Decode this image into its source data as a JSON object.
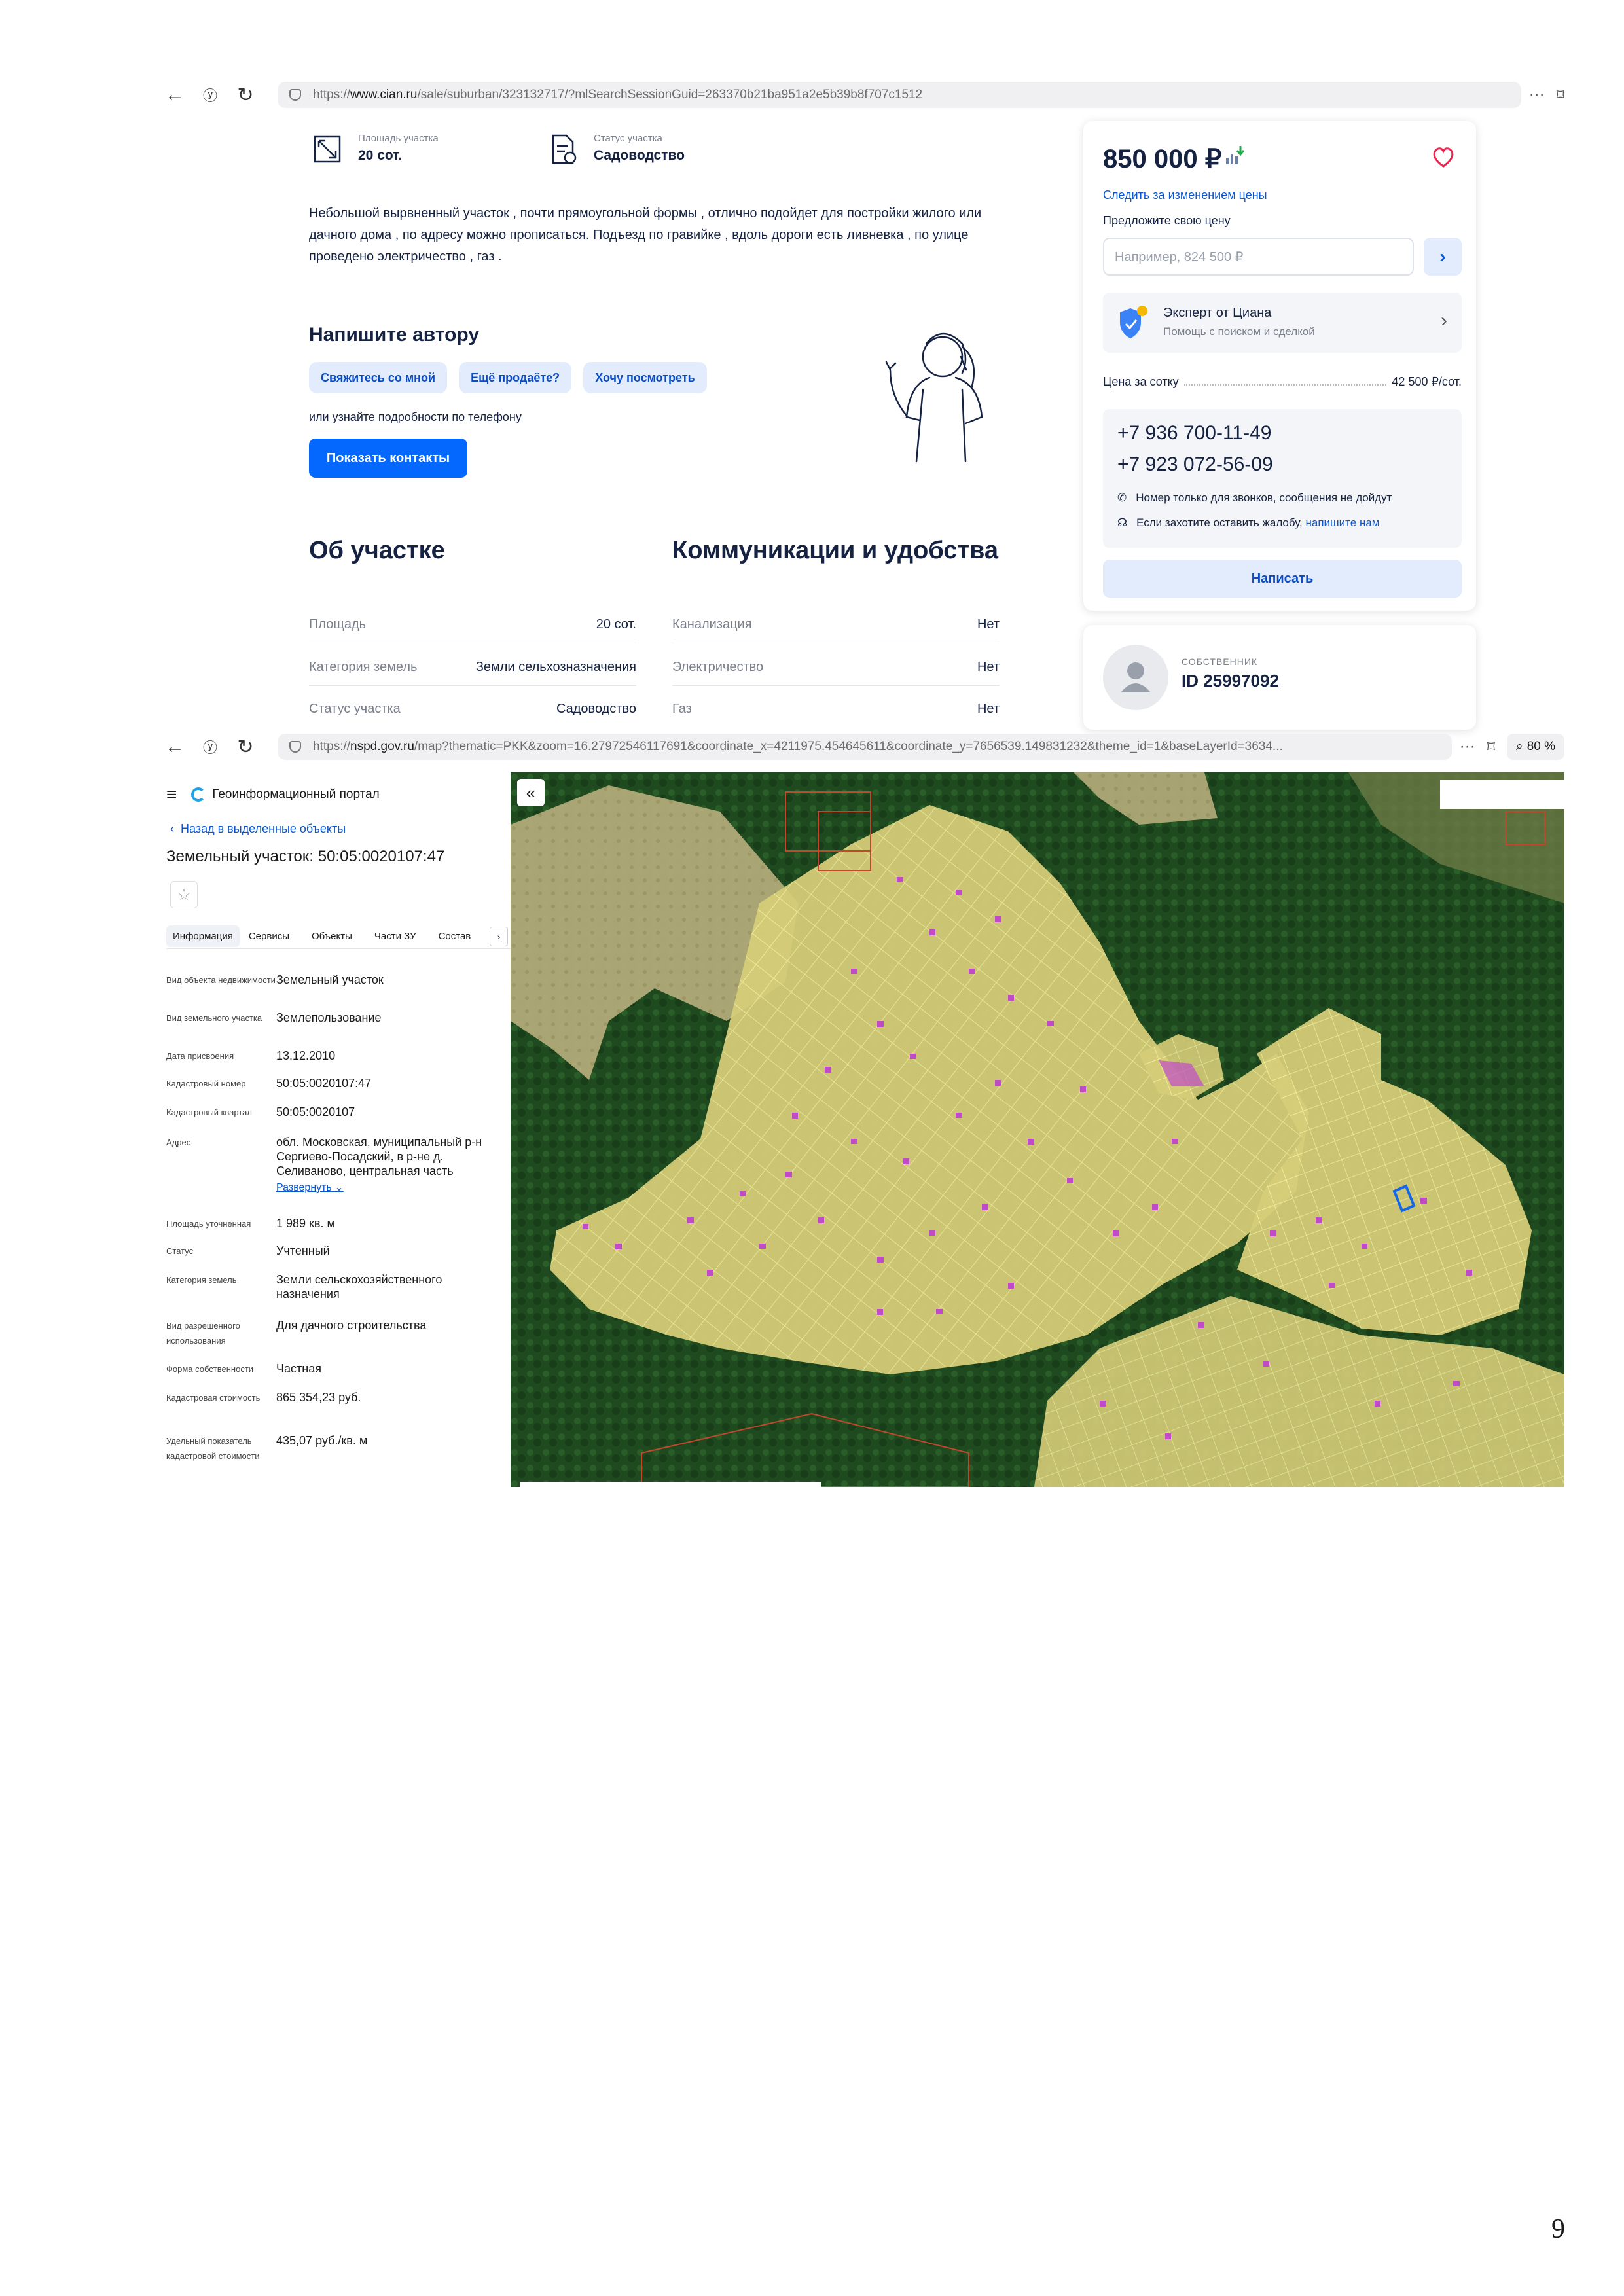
{
  "browser_top": {
    "url_prefix": "https://",
    "url_domain": "www.cian.ru",
    "url_path": "/sale/suburban/323132717/?mlSearchSessionGuid=263370b21ba951a2e5b39b8f707c1512"
  },
  "cian": {
    "features": [
      {
        "label": "Площадь участка",
        "value": "20 сот.",
        "icon": "area-icon"
      },
      {
        "label": "Статус участка",
        "value": "Садоводство",
        "icon": "document-icon"
      }
    ],
    "description": "Небольшой вырвненный участок , почти прямоугольной формы , отлично подойдет для постройки жилого или дачного дома , по адресу можно прописаться. Подъезд по гравийке , вдоль дороги есть ливневка , по улице проведено электричество , газ .",
    "write_heading": "Напишите автору",
    "chips": [
      "Свяжитесь со мной",
      "Ещё продаёте?",
      "Хочу посмотреть"
    ],
    "phone_hint": "или узнайте подробности по телефону",
    "show_contacts": "Показать контакты",
    "about_heading": "Об участке",
    "about": [
      {
        "k": "Площадь",
        "v": "20 сот."
      },
      {
        "k": "Категория земель",
        "v": "Земли сельхозназначения"
      },
      {
        "k": "Статус участка",
        "v": "Садоводство"
      }
    ],
    "comm_heading": "Коммуникации и удобства",
    "comm": [
      {
        "k": "Канализация",
        "v": "Нет"
      },
      {
        "k": "Электричество",
        "v": "Нет"
      },
      {
        "k": "Газ",
        "v": "Нет"
      }
    ],
    "sidebar": {
      "price": "850 000 ₽",
      "follow": "Следить за изменением цены",
      "offer_label": "Предложите свою цену",
      "offer_placeholder": "Например, 824 500 ₽",
      "expert_title": "Эксперт от Циана",
      "expert_sub": "Помощь с поиском и сделкой",
      "per_sotka_label": "Цена за сотку",
      "per_sotka_value": "42 500 ₽/сот.",
      "phone1": "+7 936 700-11-49",
      "phone2": "+7 923 072-56-09",
      "note1": "Номер только для звонков, сообщения не дойдут",
      "note2": "Если захотите оставить жалобу,",
      "note2_link": "напишите нам",
      "write_btn": "Написать",
      "owner_label": "СОБСТВЕННИК",
      "owner_id": "ID 25997092"
    }
  },
  "browser_bottom": {
    "url_prefix": "https://",
    "url_domain": "nspd.gov.ru",
    "url_path": "/map?thematic=PKK&zoom=16.27972546117691&coordinate_x=4211975.454645611&coordinate_y=7656539.149831232&theme_id=1&baseLayerId=3634...",
    "zoom": "80 %"
  },
  "nspd": {
    "portal": "Геоинформационный портал",
    "back": "Назад в выделенные объекты",
    "title": "Земельный участок: 50:05:0020107:47",
    "tabs": [
      "Информация",
      "Сервисы",
      "Объекты",
      "Части ЗУ",
      "Состав"
    ],
    "props": [
      {
        "k": "Вид объекта недвижимости",
        "v": "Земельный участок"
      },
      {
        "k": "Вид земельного участка",
        "v": "Землепользование"
      },
      {
        "k": "Дата присвоения",
        "v": "13.12.2010"
      },
      {
        "k": "Кадастровый номер",
        "v": "50:05:0020107:47"
      },
      {
        "k": "Кадастровый квартал",
        "v": "50:05:0020107"
      },
      {
        "k": "Адрес",
        "v": "обл. Московская, муниципальный р-н Сергиево-Посадский, в р-не д. Селиваново, центральная часть",
        "extra": "Развернуть"
      },
      {
        "k": "Площадь уточненная",
        "v": "1 989 кв. м"
      },
      {
        "k": "Статус",
        "v": "Учтенный"
      },
      {
        "k": "Категория земель",
        "v": "Земли сельскохозяйственного назначения"
      },
      {
        "k": "Вид разрешенного использования",
        "v": "Для дачного строительства"
      },
      {
        "k": "Форма собственности",
        "v": "Частная"
      },
      {
        "k": "Кадастровая стоимость",
        "v": "865 354,23 руб."
      },
      {
        "k": "Удельный показатель кадастровой стоимости",
        "v": "435,07 руб./кв. м"
      }
    ]
  },
  "page_number": "9",
  "colors": {
    "cian_blue": "#0468ff",
    "parcel_fill": "#d9d07a",
    "forest": "#214d22",
    "building": "#c04bc7"
  }
}
